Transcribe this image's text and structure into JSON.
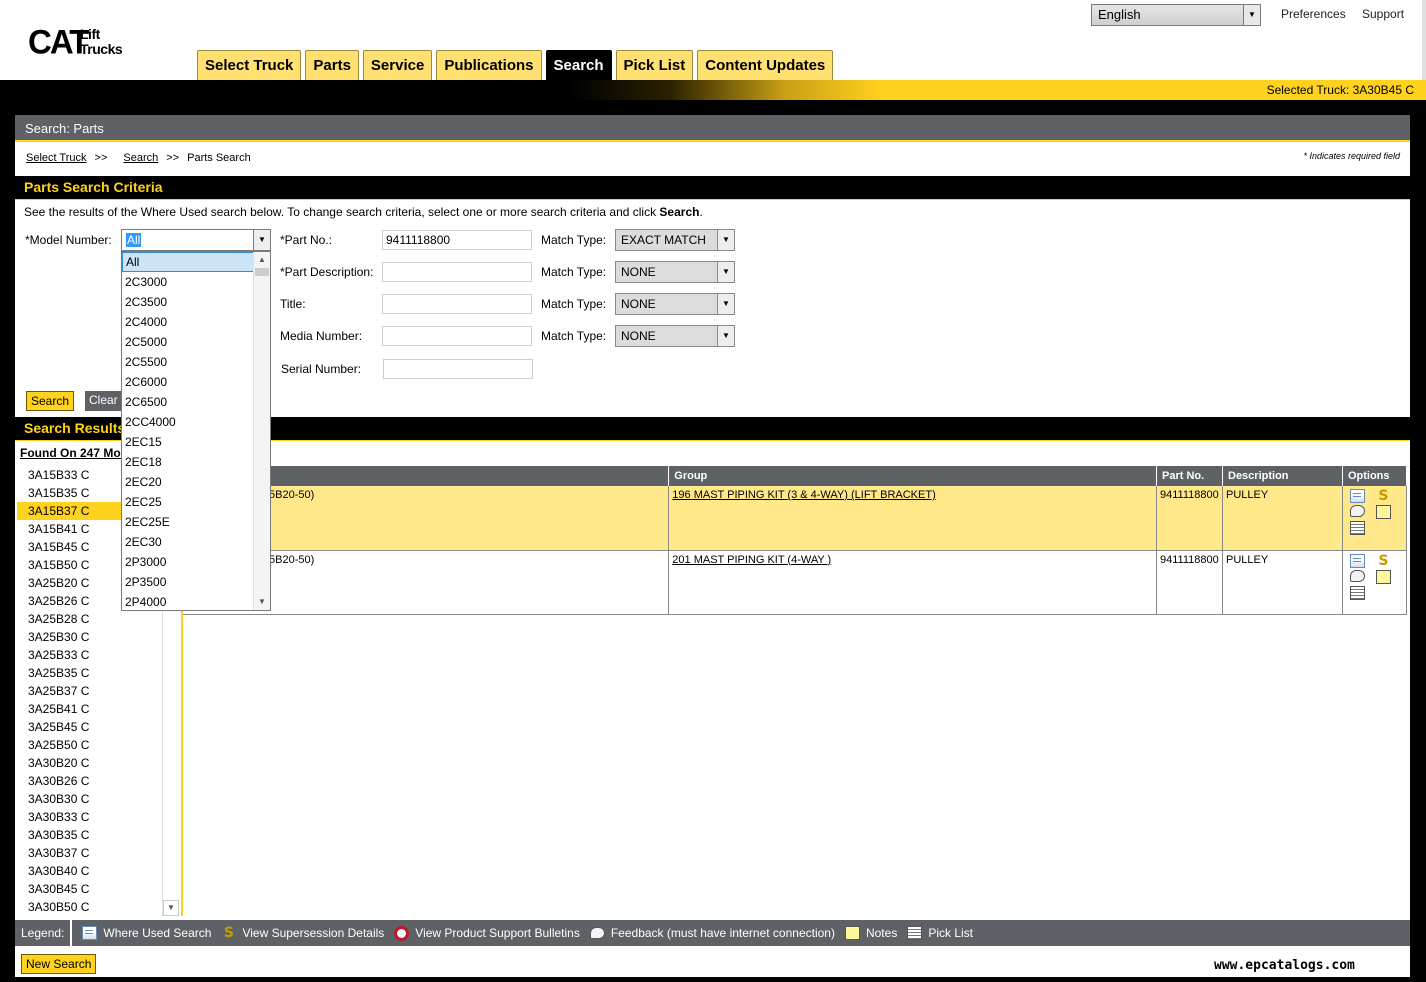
{
  "header": {
    "logo_main": "CAT",
    "logo_sub_1": "Lift",
    "logo_sub_2": "Trucks",
    "language": "English",
    "links": [
      "Preferences",
      "Support"
    ]
  },
  "tabs": [
    {
      "label": "Select Truck",
      "active": false
    },
    {
      "label": "Parts",
      "active": false
    },
    {
      "label": "Service",
      "active": false
    },
    {
      "label": "Publications",
      "active": false
    },
    {
      "label": "Search",
      "active": true
    },
    {
      "label": "Pick List",
      "active": false
    },
    {
      "label": "Content Updates",
      "active": false
    }
  ],
  "selected_truck": "Selected Truck:  3A30B45 C",
  "panel_title": "Search: Parts",
  "breadcrumb": {
    "items": [
      "Select Truck",
      "Search"
    ],
    "current": "Parts Search",
    "separator": ">>"
  },
  "required_note": "* Indicates required field",
  "criteria": {
    "title": "Parts Search Criteria",
    "intro_text": "See the results of the Where Used search below.  To change search criteria, select one or more search criteria and click ",
    "intro_bold": "Search",
    "intro_end": ".",
    "model_number_label": "*Model Number:",
    "model_number_value": "All",
    "fields": [
      {
        "label": "*Part No.:",
        "value": "9411118800",
        "match_label": "Match Type:",
        "match_value": "EXACT MATCH"
      },
      {
        "label": "*Part Description:",
        "value": "",
        "match_label": "Match Type:",
        "match_value": "NONE"
      },
      {
        "label": "Title:",
        "value": "",
        "match_label": "Match Type:",
        "match_value": "NONE"
      },
      {
        "label": "Media Number:",
        "value": "",
        "match_label": "Match Type:",
        "match_value": "NONE"
      },
      {
        "label": "Serial Number:",
        "value": ""
      }
    ],
    "search_button": "Search",
    "clear_button": "Clear"
  },
  "dropdown_options": [
    "All",
    "2C3000",
    "2C3500",
    "2C4000",
    "2C5000",
    "2C5500",
    "2C6000",
    "2C6500",
    "2CC4000",
    "2EC15",
    "2EC18",
    "2EC20",
    "2EC25",
    "2EC25E",
    "2EC30",
    "2P3000",
    "2P3500",
    "2P4000"
  ],
  "results": {
    "title": "Search Results",
    "found_text": "Found On 247 Models",
    "models": [
      "3A15B33 C",
      "3A15B35 C",
      "3A15B37 C",
      "3A15B41 C",
      "3A15B45 C",
      "3A15B50 C",
      "3A25B20 C",
      "3A25B26 C",
      "3A25B28 C",
      "3A25B30 C",
      "3A25B33 C",
      "3A25B35 C",
      "3A25B37 C",
      "3A25B41 C",
      "3A25B45 C",
      "3A25B50 C",
      "3A30B20 C",
      "3A30B26 C",
      "3A30B30 C",
      "3A30B33 C",
      "3A30B35 C",
      "3A30B37 C",
      "3A30B40 C",
      "3A30B45 C",
      "3A30B50 C"
    ],
    "selected_model": "3A15B37 C",
    "columns": [
      "Group",
      "Part No.",
      "Description",
      "Options"
    ],
    "rows": [
      {
        "title_fragment": "5B20-50)",
        "group": "196 MAST PIPING KIT (3 & 4-WAY) (LIFT BRACKET)",
        "part_no": "9411118800",
        "description": "PULLEY"
      },
      {
        "title_fragment": "5B20-50)",
        "group": "201 MAST PIPING KIT (4-WAY )",
        "part_no": "9411118800",
        "description": "PULLEY"
      }
    ]
  },
  "legend": {
    "label": "Legend:",
    "items": [
      {
        "icon": "where-used-icon",
        "text": "Where Used Search"
      },
      {
        "icon": "supersession-icon",
        "text": "View Supersession Details"
      },
      {
        "icon": "product-support-bulletin-icon",
        "text": "View Product Support Bulletins"
      },
      {
        "icon": "feedback-icon",
        "text": "Feedback (must have internet connection)"
      },
      {
        "icon": "notes-icon",
        "text": "Notes"
      },
      {
        "icon": "pick-list-icon",
        "text": "Pick List"
      }
    ]
  },
  "new_search_button": "New Search",
  "watermark": "www.epcatalogs.com",
  "colors": {
    "brand_yellow": "#ffd21e",
    "header_gray": "#5e6266",
    "row_highlight": "#ffe889"
  }
}
